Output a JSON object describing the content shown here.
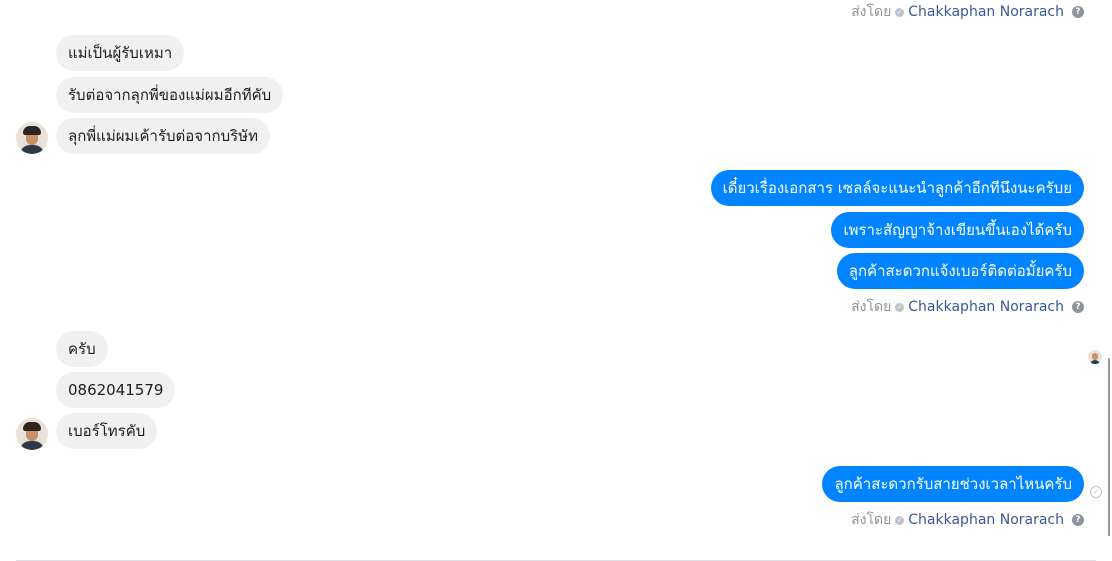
{
  "sent_by": {
    "prefix": "ส่งโดย",
    "name": "Chakkaphan Norarach",
    "help": "?"
  },
  "messages": [
    {
      "text": "แม่เป็นผู้รับเหมา",
      "direction": "incoming"
    },
    {
      "text": "รับต่อจากลุกพี่ของแม่ผมอีกทีคับ",
      "direction": "incoming"
    },
    {
      "text": "ลุกพี่แม่ผมเค้ารับต่อจากบริษัท",
      "direction": "incoming"
    },
    {
      "text": "เดี๋ยวเรื่องเอกสาร เซลล์จะแนะนำลูกค้าอีกทีนึงนะครับย",
      "direction": "outgoing"
    },
    {
      "text": "เพราะสัญญาจ้างเขียนขึ้นเองได้ครับ",
      "direction": "outgoing"
    },
    {
      "text": "ลูกค้าสะดวกแจ้งเบอร์ติดต่อมั้ยครับ",
      "direction": "outgoing"
    },
    {
      "text": "ครับ",
      "direction": "incoming"
    },
    {
      "text": "0862041579",
      "direction": "incoming"
    },
    {
      "text": "เบอร์โทรคับ",
      "direction": "incoming"
    },
    {
      "text": "ลูกค้าสะดวกรับสายช่วงเวลาไหนครับ",
      "direction": "outgoing"
    }
  ],
  "icons": {
    "check": "✓",
    "sent": "✓"
  },
  "colors": {
    "outgoing_bubble": "#0084ff",
    "incoming_bubble": "#f1f0f0",
    "link": "#385898"
  }
}
